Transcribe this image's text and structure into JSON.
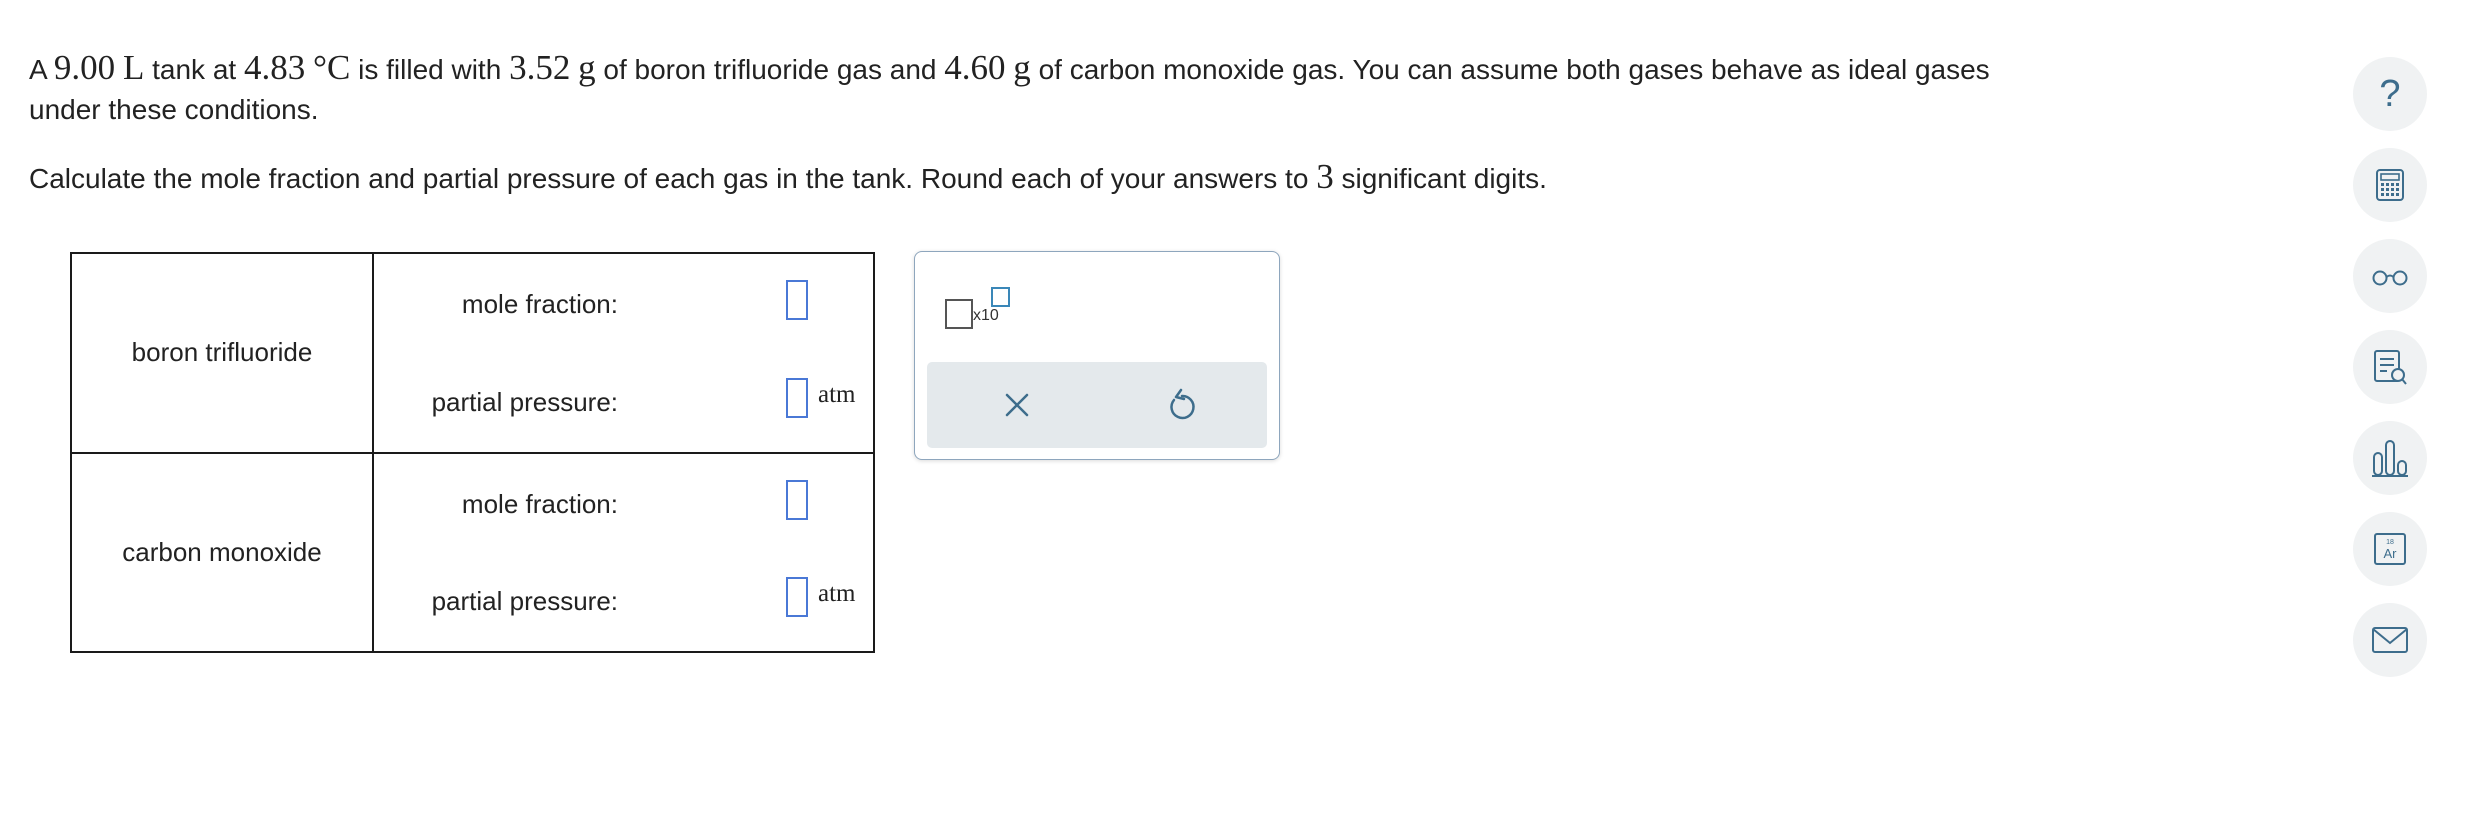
{
  "problem": {
    "line1": {
      "t1": "A ",
      "vol_num": "9.00",
      "vol_unit": "L",
      "t2": " tank at ",
      "temp_num": "4.83",
      "temp_unit": "°C",
      "t3": " is filled with ",
      "mass1_num": "3.52",
      "mass1_unit": "g",
      "t4": " of boron trifluoride gas and ",
      "mass2_num": "4.60",
      "mass2_unit": "g",
      "t5": " of carbon monoxide gas. You can assume both gases behave as ideal gases",
      "t6": "under these conditions."
    },
    "line2": {
      "t1": "Calculate the mole fraction and partial pressure of each gas in the tank. Round each of your answers to ",
      "sig": "3",
      "t2": " significant digits."
    }
  },
  "table": {
    "rows": [
      {
        "gas": "boron trifluoride",
        "mole_fraction_label": "mole fraction:",
        "mole_fraction_value": "",
        "partial_pressure_label": "partial pressure:",
        "partial_pressure_value": "",
        "pressure_unit": "atm"
      },
      {
        "gas": "carbon monoxide",
        "mole_fraction_label": "mole fraction:",
        "mole_fraction_value": "",
        "partial_pressure_label": "partial pressure:",
        "partial_pressure_value": "",
        "pressure_unit": "atm"
      }
    ]
  },
  "math_popup": {
    "x10_label": "x10",
    "buttons": [
      "clear-icon",
      "undo-icon"
    ]
  },
  "toolbar": {
    "items": [
      "help-icon",
      "calculator-icon",
      "glasses-icon",
      "worksheet-icon",
      "bar-chart-icon",
      "periodic-table-icon",
      "mail-icon"
    ],
    "help_glyph": "?",
    "periodic_number": "18",
    "periodic_symbol": "Ar"
  },
  "colors": {
    "input_border": "#4a78d6",
    "icon": "#3d6d8c",
    "toolbar_bg": "#f0f2f3",
    "popup_bar_bg": "#e4e9ec"
  }
}
